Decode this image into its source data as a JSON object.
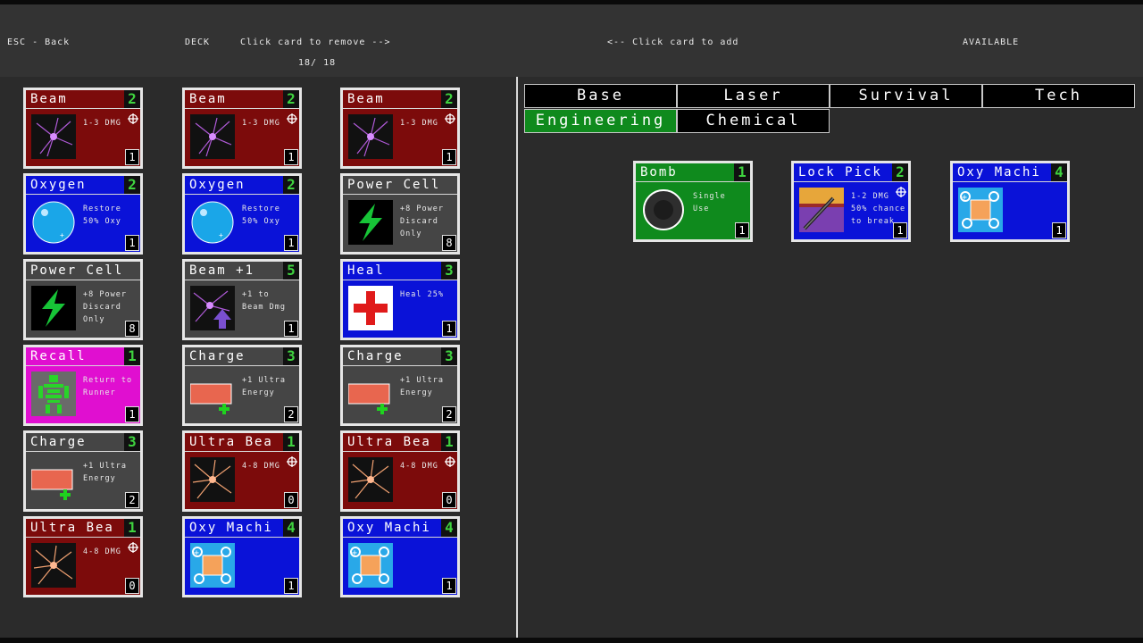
{
  "header": {
    "back": "ESC - Back",
    "deck_label": "DECK",
    "remove_hint": "Click card to remove -->",
    "deck_count": "18/ 18",
    "add_hint": "<-- Click card to add",
    "available_label": "AVAILABLE"
  },
  "tabs": [
    {
      "label": "Base",
      "active": false
    },
    {
      "label": "Laser",
      "active": false
    },
    {
      "label": "Survival",
      "active": false
    },
    {
      "label": "Tech",
      "active": false
    },
    {
      "label": "Engineering",
      "active": true
    },
    {
      "label": "Chemical",
      "active": false
    }
  ],
  "colors": {
    "red": "#7c0b0b",
    "blue": "#0a12d8",
    "gray": "#454545",
    "magenta": "#e00fd0",
    "green": "#0f8a1d",
    "cost": "#3fd33f"
  },
  "deck": [
    {
      "title": "Beam",
      "cost": "2",
      "desc": "1-3 DMG",
      "count": "1",
      "color": "red",
      "icon": "beam-icon",
      "target": true
    },
    {
      "title": "Beam",
      "cost": "2",
      "desc": "1-3 DMG",
      "count": "1",
      "color": "red",
      "icon": "beam-icon",
      "target": true
    },
    {
      "title": "Beam",
      "cost": "2",
      "desc": "1-3 DMG",
      "count": "1",
      "color": "red",
      "icon": "beam-icon",
      "target": true
    },
    {
      "title": "Oxygen",
      "cost": "2",
      "desc": "Restore\n50% Oxy",
      "count": "1",
      "color": "blue",
      "icon": "oxygen-bubble-icon",
      "target": false
    },
    {
      "title": "Oxygen",
      "cost": "2",
      "desc": "Restore\n50% Oxy",
      "count": "1",
      "color": "blue",
      "icon": "oxygen-bubble-icon",
      "target": false
    },
    {
      "title": "Power Cell",
      "cost": "",
      "desc": "+8 Power\nDiscard\nOnly",
      "count": "8",
      "color": "gray",
      "icon": "lightning-bolt-icon",
      "target": false
    },
    {
      "title": "Power Cell",
      "cost": "",
      "desc": "+8 Power\nDiscard\nOnly",
      "count": "8",
      "color": "gray",
      "icon": "lightning-bolt-icon",
      "target": false
    },
    {
      "title": "Beam +1",
      "cost": "5",
      "desc": "+1 to\nBeam Dmg",
      "count": "1",
      "color": "gray",
      "icon": "beam-upgrade-icon",
      "target": false
    },
    {
      "title": "Heal",
      "cost": "3",
      "desc": "Heal 25%",
      "count": "1",
      "color": "blue",
      "icon": "medical-cross-icon",
      "target": false
    },
    {
      "title": "Recall",
      "cost": "1",
      "desc": "Return to\nRunner",
      "count": "1",
      "color": "magenta",
      "icon": "robot-icon",
      "target": false
    },
    {
      "title": "Charge",
      "cost": "3",
      "desc": "+1 Ultra\nEnergy",
      "count": "2",
      "color": "gray",
      "icon": "battery-charge-icon",
      "target": false
    },
    {
      "title": "Charge",
      "cost": "3",
      "desc": "+1 Ultra\nEnergy",
      "count": "2",
      "color": "gray",
      "icon": "battery-charge-icon",
      "target": false
    },
    {
      "title": "Charge",
      "cost": "3",
      "desc": "+1 Ultra\nEnergy",
      "count": "2",
      "color": "gray",
      "icon": "battery-charge-icon",
      "target": false
    },
    {
      "title": "Ultra Bea",
      "cost": "1",
      "desc": "4-8 DMG",
      "count": "0",
      "color": "red",
      "icon": "ultra-beam-icon",
      "target": true
    },
    {
      "title": "Ultra Bea",
      "cost": "1",
      "desc": "4-8 DMG",
      "count": "0",
      "color": "red",
      "icon": "ultra-beam-icon",
      "target": true
    },
    {
      "title": "Ultra Bea",
      "cost": "1",
      "desc": "4-8 DMG",
      "count": "0",
      "color": "red",
      "icon": "ultra-beam-icon",
      "target": true
    },
    {
      "title": "Oxy Machi",
      "cost": "4",
      "desc": "",
      "count": "1",
      "color": "blue",
      "icon": "oxygen-machine-icon",
      "target": false
    },
    {
      "title": "Oxy Machi",
      "cost": "4",
      "desc": "",
      "count": "1",
      "color": "blue",
      "icon": "oxygen-machine-icon",
      "target": false
    }
  ],
  "available": [
    {
      "title": "Bomb",
      "cost": "1",
      "desc": "Single\nUse",
      "count": "1",
      "color": "green",
      "icon": "bomb-icon",
      "target": false
    },
    {
      "title": "Lock Pick",
      "cost": "2",
      "desc": "1-2 DMG\n50% chance\nto break",
      "count": "1",
      "color": "blue",
      "icon": "lock-pick-icon",
      "target": true
    },
    {
      "title": "Oxy Machi",
      "cost": "4",
      "desc": "",
      "count": "1",
      "color": "blue",
      "icon": "oxygen-machine-icon",
      "target": false
    }
  ]
}
